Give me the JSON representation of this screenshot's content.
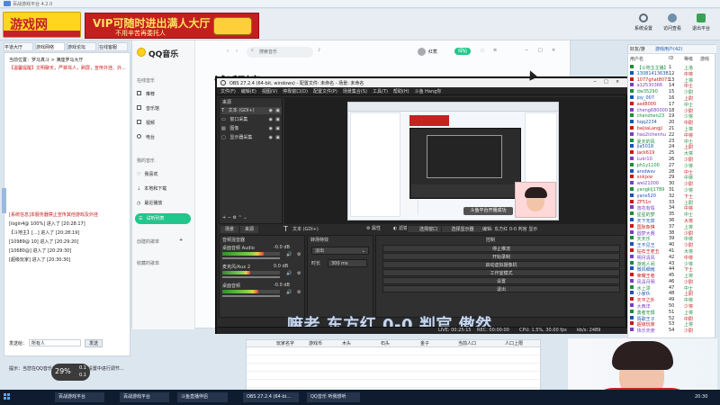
{
  "colors": {
    "banner_yellow": "#ffd51d",
    "banner_red": "#b81e1e",
    "qq_green": "#22c68c",
    "obs_dark": "#272727",
    "obs_panel": "#303030",
    "taskbar": "#0f1c2f",
    "list_green": "#2b9b3f"
  },
  "top_banner": {
    "logo_text": "游戏网",
    "vip_title": "VIP可随时进出满人大厅",
    "vip_subtitle": "不用辛苦再委托人"
  },
  "top_tabs": [
    "平道大厅",
    "游戏网络",
    "游戏论坛",
    "在线客服"
  ],
  "left_chat": {
    "notice_1": "【温馨提醒】文明聊天，严禁骂人，刷屏，宣传外挂、外挂等",
    "messages": [
      "[系统信息]本服务器禁止宣传其他游戏及外挂",
      "[login4@ 100%] 进入了 [20:28:17]",
      "【斗地主】[...] 进入了 [20:28:19]",
      "[10989@ 10] 进入了 [20:29:20]",
      "[10680@] 进入了 [20:29:30]",
      "[超级玩家] 进入了 [20:30:30]"
    ],
    "input_label": "发送给：",
    "input_value": "所有人",
    "send_label": "发送",
    "bottom_tip": "提示：当您在QQ音乐主播上卡顿，请在设置中进行调节，同时关闭后台音乐程序"
  },
  "qq_music": {
    "brand": "QQ音乐",
    "search_placeholder": "搜索音乐",
    "nav_online": "在线音乐",
    "nav_items": [
      "推荐",
      "音乐馆",
      "视频",
      "电台"
    ],
    "nav_mine": "我的音乐",
    "mine_items": [
      "我喜欢",
      "本地和下载",
      "最近播放",
      "试听列表"
    ],
    "section_created": "创建的歌单",
    "section_fav": "收藏的歌单",
    "page_title": "试听列表",
    "vip_badge": "绿钻",
    "user_label": "红蕉",
    "window_controls": [
      "最小化",
      "最大化",
      "关闭"
    ]
  },
  "obs": {
    "title": "OBS 27.2.4 (64-bit, windows) - 配置文件: 未命名 - 场景: 未命名",
    "menu": [
      "文件(F)",
      "编辑(E)",
      "视图(V)",
      "停靠窗口(D)",
      "配置文件(P)",
      "场景集合(S)",
      "工具(T)",
      "帮助(H)",
      "斗鱼 Hang你"
    ],
    "sources_header": "来源",
    "sources": [
      "文本 (GDI+)",
      "窗口采集",
      "图像",
      "显示器采集"
    ],
    "tabs": [
      "场景",
      "来源"
    ],
    "text_source_label": "文本 (GDI+)",
    "mixer_header": "音频混音器",
    "transition_header": "转场特效",
    "controls_header": "控制",
    "properties_label": "属性",
    "filters_label": "滤镜",
    "select_window_label": "选择窗口",
    "select_display_label": "选择显示器",
    "hotkey_label": "编辑: 东方红 0-0 判官 显示",
    "tracks": [
      {
        "name": "桌面音频 Audio",
        "db": "-0.0 dB",
        "level": 0.72
      },
      {
        "name": "麦克风/Aux 2",
        "db": "0.0 dB",
        "level": 0.48
      },
      {
        "name": "桌面音频",
        "db": "-0.0 dB",
        "level": 0.63
      }
    ],
    "transition_type": "淡出",
    "transition_duration": "300 ms",
    "duration_label": "时长",
    "control_buttons": [
      "停止推流",
      "开始录制",
      "启动虚拟摄像机",
      "工作室模式",
      "设置",
      "退出"
    ],
    "status": {
      "live": "LIVE: 00:25:15",
      "rec": "REC: 00:00:00",
      "cpu": "CPU: 1.5%, 30.00 fps",
      "kbps": "kb/s: 2489"
    },
    "overlay_text": "嘛老 东方红 0-0 判官 傲然",
    "preview_label": "斗鱼平台开播成功"
  },
  "right_panel": {
    "top_icons": [
      "系统设置",
      "访问查看",
      "退出平台"
    ],
    "tabs": [
      "好友/游",
      "游戏用户(42)"
    ],
    "list_headers": [
      "用户名",
      "ID",
      "等级",
      "游戏"
    ],
    "users": [
      {
        "name": "【斗地主主播】",
        "id": "1",
        "tag": "上洛"
      },
      {
        "name": "1308141363B",
        "id": "12",
        "tag": "中将"
      },
      {
        "name": "1077ghat8071",
        "id": "13",
        "tag": "上将"
      },
      {
        "name": "a12530366",
        "id": "14",
        "tag": "中士"
      },
      {
        "name": "dw35290",
        "id": "15",
        "tag": "少尉"
      },
      {
        "name": "joy_007",
        "id": "16",
        "tag": "上尉"
      },
      {
        "name": "asd8000",
        "id": "17",
        "tag": "中士"
      },
      {
        "name": "cheng680000",
        "id": "18",
        "tag": "少尉"
      },
      {
        "name": "chenzhen23",
        "id": "19",
        "tag": "少将"
      },
      {
        "name": "hqq2234",
        "id": "20",
        "tag": "中尉"
      },
      {
        "name": "baijiaLangji",
        "id": "21",
        "tag": "上将"
      },
      {
        "name": "hao2ichenhu",
        "id": "22",
        "tag": "中将"
      },
      {
        "name": "夏天的风",
        "id": "23",
        "tag": "中士"
      },
      {
        "name": "jia5018",
        "id": "24",
        "tag": "上尉"
      },
      {
        "name": "Jack619",
        "id": "25",
        "tag": "大将"
      },
      {
        "name": "Lukr10",
        "id": "26",
        "tag": "少尉"
      },
      {
        "name": "ph1y1100",
        "id": "27",
        "tag": "少将"
      },
      {
        "name": "arsdwsv",
        "id": "28",
        "tag": "中士"
      },
      {
        "name": "xnkjxw",
        "id": "29",
        "tag": "中将"
      },
      {
        "name": "wei21000",
        "id": "30",
        "tag": "少尉"
      },
      {
        "name": "yangklj1789",
        "id": "31",
        "tag": "少将"
      },
      {
        "name": "yans520",
        "id": "32",
        "tag": "下士"
      },
      {
        "name": "ZF51n",
        "id": "33",
        "tag": "上尉"
      },
      {
        "name": "落花有情",
        "id": "34",
        "tag": "中将"
      },
      {
        "name": "星星的梦",
        "id": "35",
        "tag": "中士"
      },
      {
        "name": "天下无双",
        "id": "36",
        "tag": "大将"
      },
      {
        "name": "国际象棋",
        "id": "37",
        "tag": "上将"
      },
      {
        "name": "圆梦大赛",
        "id": "38",
        "tag": "少尉"
      },
      {
        "name": "天天乐",
        "id": "39",
        "tag": "中将"
      },
      {
        "name": "王不见王",
        "id": "40",
        "tag": "少尉"
      },
      {
        "name": "钻石王老五",
        "id": "41",
        "tag": "大将"
      },
      {
        "name": "明月清风",
        "id": "42",
        "tag": "中将"
      },
      {
        "name": "游戏人间",
        "id": "43",
        "tag": "少将"
      },
      {
        "name": "微风细雨",
        "id": "44",
        "tag": "下士"
      },
      {
        "name": "荣耀王者",
        "id": "45",
        "tag": "上将"
      },
      {
        "name": "风清月明",
        "id": "46",
        "tag": "少尉"
      },
      {
        "name": "水上漂",
        "id": "47",
        "tag": "中士"
      },
      {
        "name": "小家伙",
        "id": "48",
        "tag": "上尉"
      },
      {
        "name": "天平之外",
        "id": "49",
        "tag": "中将"
      },
      {
        "name": "大西洋",
        "id": "50",
        "tag": "少将"
      },
      {
        "name": "勇者无惧",
        "id": "51",
        "tag": "上将"
      },
      {
        "name": "情歌王子",
        "id": "52",
        "tag": "中尉"
      },
      {
        "name": "超级玩家",
        "id": "53",
        "tag": "上将"
      },
      {
        "name": "快乐天使",
        "id": "54",
        "tag": "少尉"
      }
    ]
  },
  "bottom_table": {
    "headers": [
      "玩家名字",
      "游戏币",
      "木头",
      "石头",
      "金子",
      "当前人口",
      "人口上限"
    ],
    "rows": [
      "",
      "",
      "",
      "",
      "",
      ""
    ]
  },
  "clock": {
    "percent": "29%",
    "line1": "0.1",
    "line2": "0.1"
  },
  "taskbar": {
    "items": [
      "百战游戏平台",
      "百战游戏平台",
      "斗鱼直播伴侣",
      "OBS 27.2.4 (64-bi...",
      "QQ音乐 听我想听"
    ],
    "time": "20:30"
  }
}
